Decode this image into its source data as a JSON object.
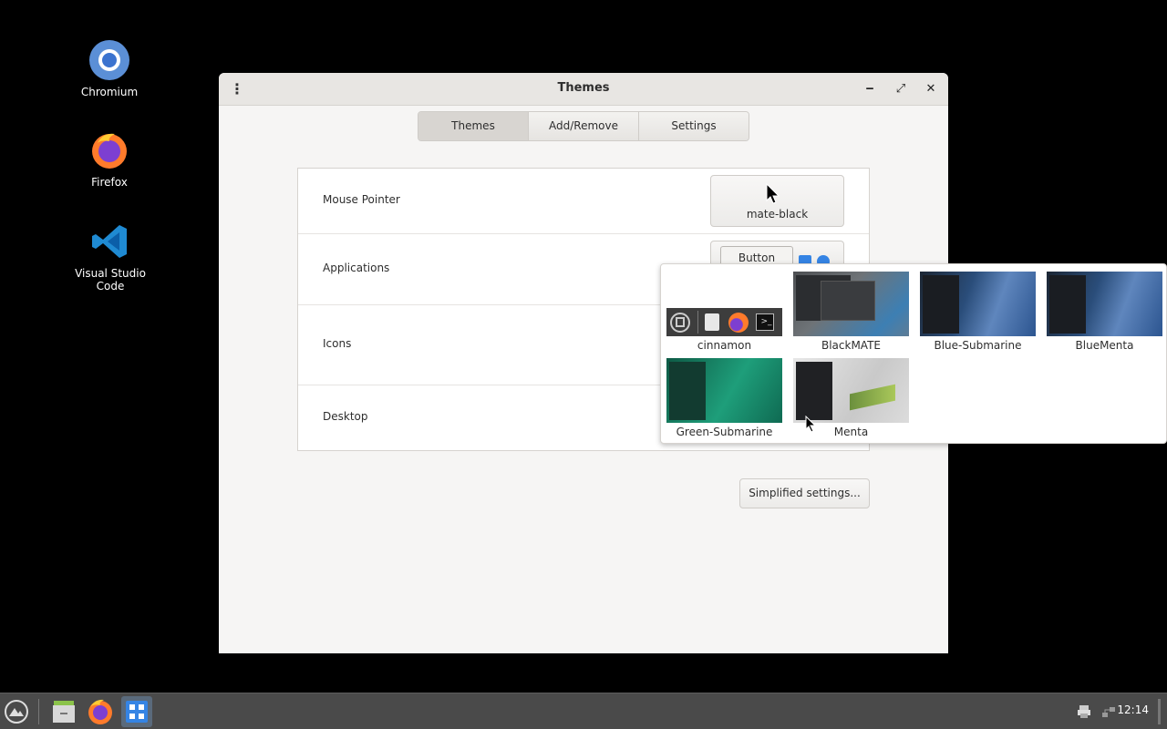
{
  "desktop": {
    "icons": [
      {
        "label": "Chromium",
        "icon": "chromium-icon"
      },
      {
        "label": "Firefox",
        "icon": "firefox-icon"
      },
      {
        "label_line1": "Visual Studio",
        "label_line2": "Code",
        "icon": "vscode-icon"
      }
    ]
  },
  "window": {
    "title": "Themes",
    "menu_glyph": "⋮",
    "minimize_glyph": "‒",
    "maximize_glyph": "⤢",
    "close_glyph": "✕",
    "tabs": [
      {
        "label": "Themes",
        "active": true
      },
      {
        "label": "Add/Remove",
        "active": false
      },
      {
        "label": "Settings",
        "active": false
      }
    ],
    "rows": [
      {
        "label": "Mouse Pointer",
        "value": "mate-black"
      },
      {
        "label": "Applications",
        "preview_button": "Button"
      },
      {
        "label": "Icons"
      },
      {
        "label": "Desktop"
      }
    ],
    "simplified_button": "Simplified settings..."
  },
  "popover": {
    "themes": [
      {
        "name": "cinnamon"
      },
      {
        "name": "BlackMATE"
      },
      {
        "name": "Blue-Submarine"
      },
      {
        "name": "BlueMenta"
      },
      {
        "name": "Green-Submarine"
      },
      {
        "name": "Menta"
      }
    ]
  },
  "taskbar": {
    "clock": "12:14"
  },
  "colors": {
    "accent": "#3584e4",
    "taskbar_bg": "#4a4a4a",
    "window_bg": "#f6f5f4"
  }
}
